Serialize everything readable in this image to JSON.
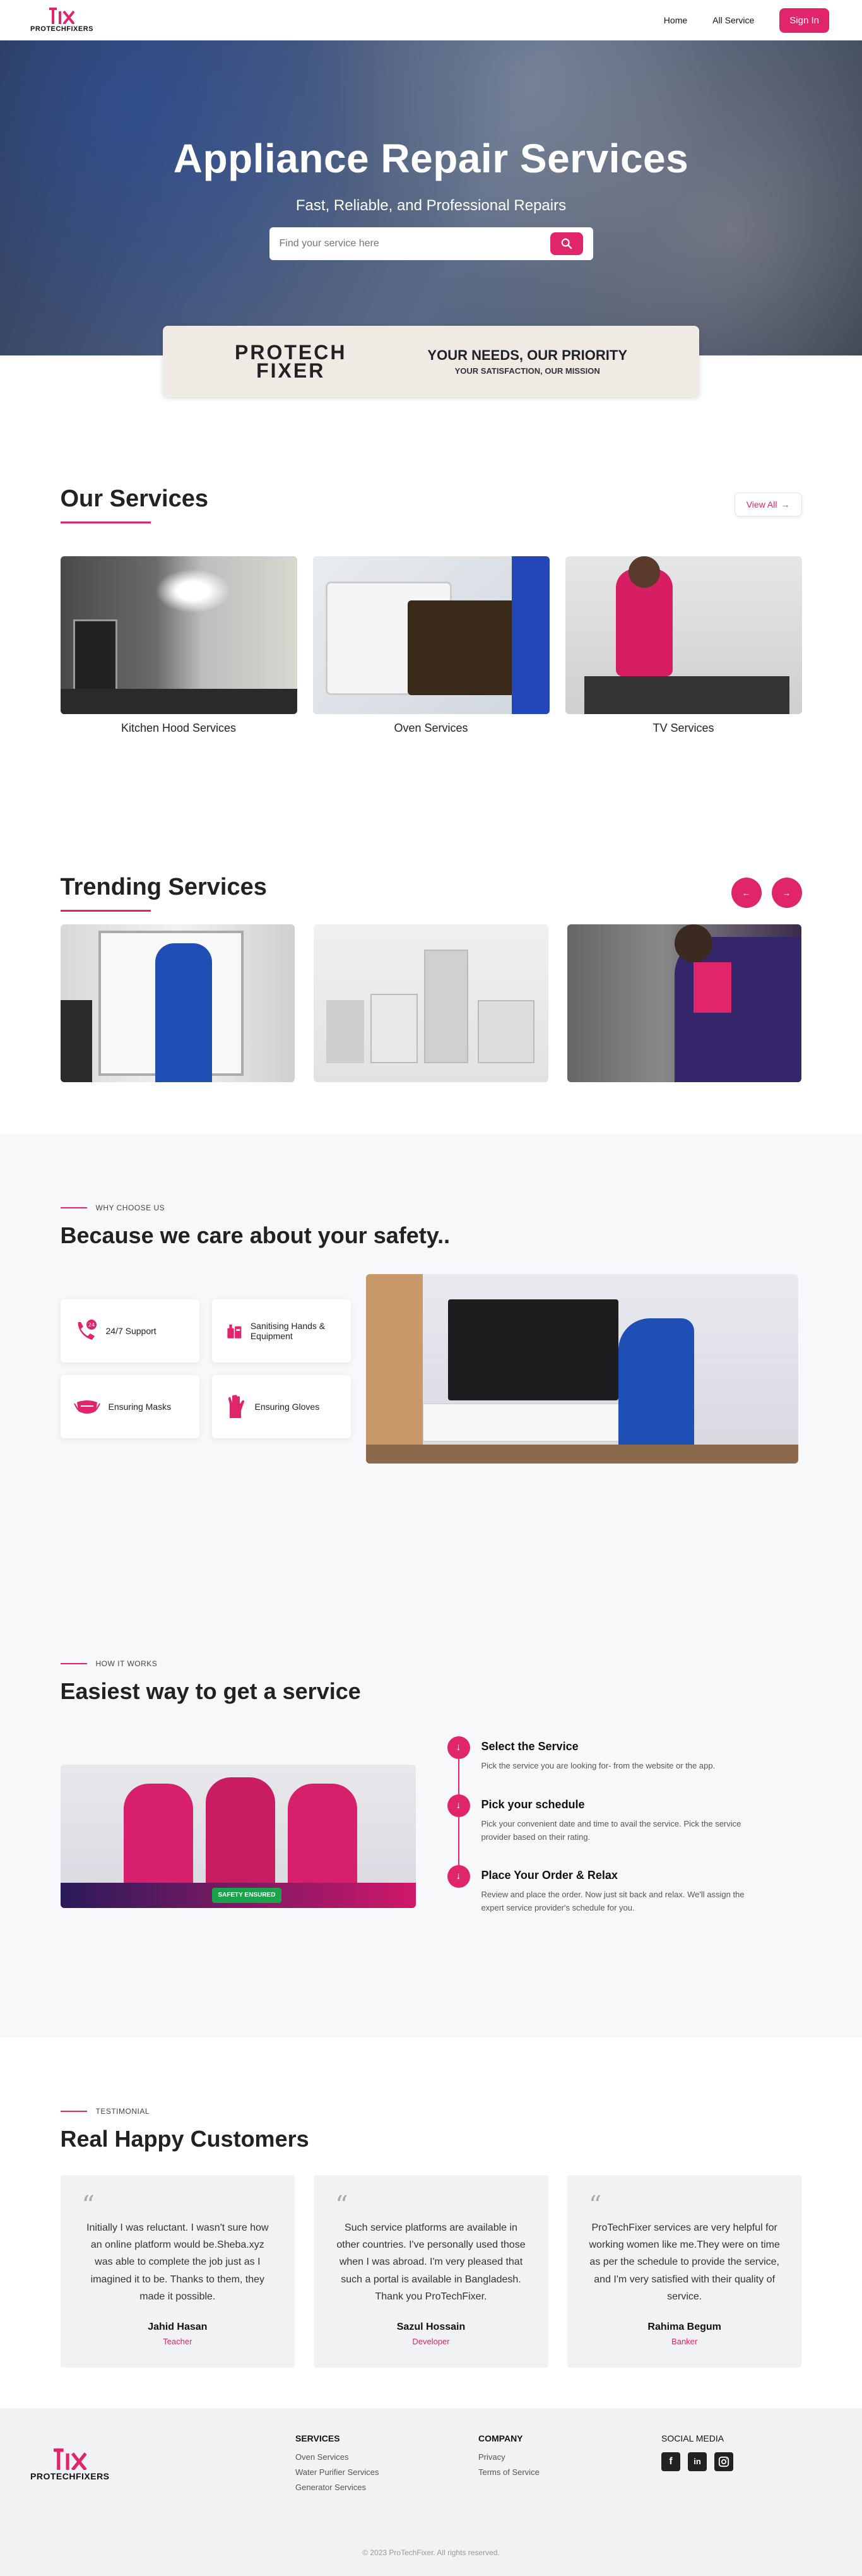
{
  "nav": {
    "logo_text": "PROTECHFIXERS",
    "links": [
      "Home",
      "All Service"
    ],
    "signin": "Sign In"
  },
  "hero": {
    "title": "Appliance Repair Services",
    "subtitle": "Fast, Reliable, and Professional Repairs",
    "search_placeholder": "Find your service here"
  },
  "banner": {
    "brand_line1": "PROTECH",
    "brand_line2": "FIXER",
    "tag1": "YOUR NEEDS, OUR PRIORITY",
    "tag2": "YOUR SATISFACTION, OUR MISSION"
  },
  "services": {
    "title": "Our Services",
    "view_all": "View All",
    "items": [
      {
        "label": "Kitchen Hood Services"
      },
      {
        "label": "Oven Services"
      },
      {
        "label": "TV Services"
      }
    ]
  },
  "trending": {
    "title": "Trending Services"
  },
  "why": {
    "eyebrow": "WHY CHOOSE US",
    "title": "Because we care about your safety..",
    "features": [
      {
        "label": "24/7 Support",
        "icon": "phone-24-icon"
      },
      {
        "label": "Sanitising Hands & Equipment",
        "icon": "sanitizer-icon"
      },
      {
        "label": "Ensuring Masks",
        "icon": "mask-icon"
      },
      {
        "label": "Ensuring Gloves",
        "icon": "glove-icon"
      }
    ]
  },
  "how": {
    "eyebrow": "HOW IT WORKS",
    "title": "Easiest way to get a service",
    "badge": "SAFETY ENSURED",
    "steps": [
      {
        "title": "Select the Service",
        "text": "Pick the service you are looking for- from the website or the app."
      },
      {
        "title": "Pick your schedule",
        "text": "Pick your convenient date and time to avail the service. Pick the service provider based on their rating."
      },
      {
        "title": "Place Your Order & Relax",
        "text": "Review and place the order. Now just sit back and relax. We'll assign the expert service provider's schedule for you."
      }
    ]
  },
  "testimonial": {
    "eyebrow": "TESTIMONIAL",
    "title": "Real Happy Customers",
    "items": [
      {
        "text": "Initially I was reluctant. I wasn't sure how an online platform would be.Sheba.xyz was able to complete the job just as I imagined it to be. Thanks to them, they made it possible.",
        "name": "Jahid Hasan",
        "role": "Teacher"
      },
      {
        "text": "Such service platforms are available in other countries. I've personally used those when I was abroad. I'm very pleased that such a portal is available in Bangladesh. Thank you ProTechFixer.",
        "name": "Sazul Hossain",
        "role": "Developer"
      },
      {
        "text": "ProTechFixer services are very helpful for working women like me.They were on time as per the schedule to provide the service, and I'm very satisfied with their quality of service.",
        "name": "Rahima Begum",
        "role": "Banker"
      }
    ]
  },
  "footer": {
    "logo_text": "PROTECHFIXERS",
    "services_title": "SERVICES",
    "services": [
      "Oven Services",
      "Water Purifier Services",
      "Generator Services"
    ],
    "company_title": "COMPANY",
    "company": [
      "Privacy",
      "Terms of Service"
    ],
    "social_title": "SOCIAL MEDIA",
    "copyright": "© 2023 ProTechFixer. All rights reserved."
  },
  "colors": {
    "accent": "#e0256a"
  }
}
